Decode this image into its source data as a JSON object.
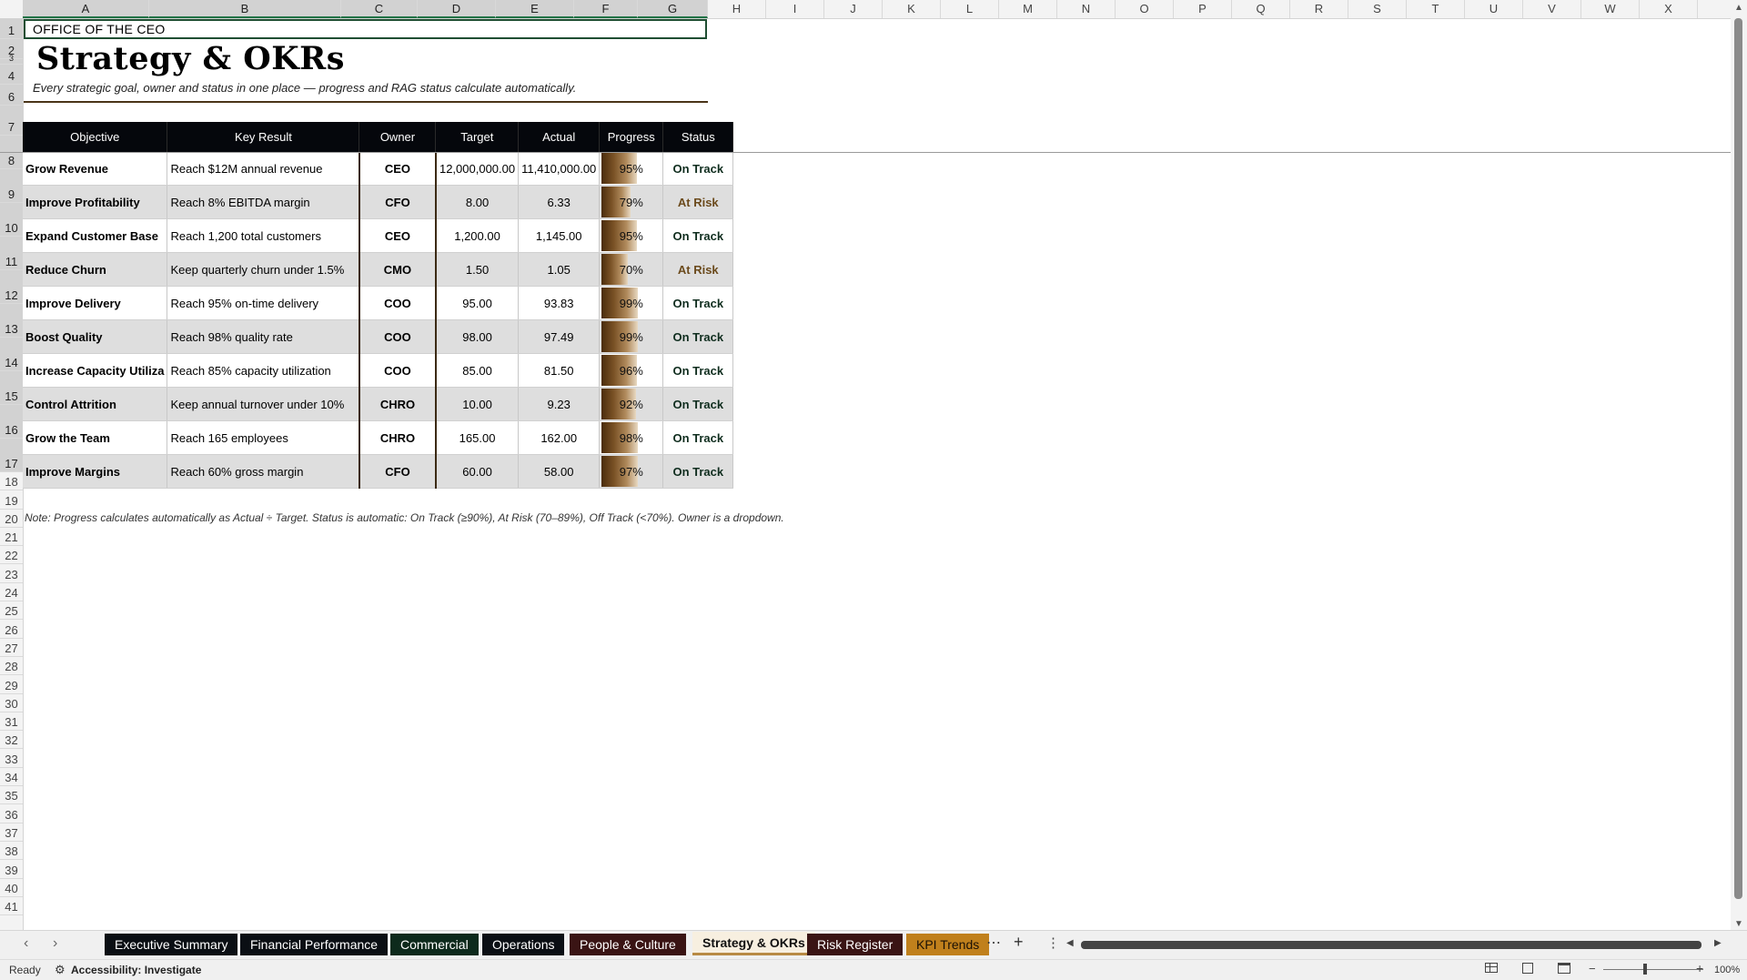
{
  "columns": [
    "A",
    "B",
    "C",
    "D",
    "E",
    "F",
    "G",
    "H",
    "I",
    "J",
    "K",
    "L",
    "M",
    "N",
    "O",
    "P",
    "Q",
    "R",
    "S",
    "T",
    "U",
    "V",
    "W",
    "X"
  ],
  "rows": [
    "1",
    "2",
    "3",
    "4",
    "5",
    "6",
    "7",
    "8",
    "9",
    "10",
    "11",
    "12",
    "13",
    "14",
    "15",
    "16",
    "17",
    "18",
    "19",
    "20",
    "21",
    "22",
    "23",
    "24",
    "25",
    "26",
    "27",
    "28",
    "29",
    "30",
    "31",
    "32",
    "33",
    "34",
    "35",
    "36",
    "37",
    "38",
    "39",
    "40",
    "41"
  ],
  "sheet": {
    "ceo_label": "OFFICE OF THE CEO",
    "title": "Strategy & OKRs",
    "subtitle": "Every strategic goal, owner and status in one place — progress and RAG status calculate automatically.",
    "note": "Note: Progress calculates automatically as Actual ÷ Target. Status is automatic: On Track (≥90%), At Risk (70–89%), Off Track (<70%). Owner is a dropdown."
  },
  "table": {
    "headers": [
      "Objective",
      "Key Result",
      "Owner",
      "Target",
      "Actual",
      "Progress",
      "Status"
    ],
    "rows": [
      {
        "objective": "Grow Revenue",
        "key_result": "Reach $12M annual revenue",
        "owner": "CEO",
        "target": "12,000,000.00",
        "actual": "11,410,000.00",
        "progress": "95%",
        "progress_value": 0.95,
        "status": "On Track"
      },
      {
        "objective": "Improve Profitability",
        "key_result": "Reach 8% EBITDA margin",
        "owner": "CFO",
        "target": "8.00",
        "actual": "6.33",
        "progress": "79%",
        "progress_value": 0.79,
        "status": "At Risk"
      },
      {
        "objective": "Expand Customer Base",
        "key_result": "Reach 1,200 total customers",
        "owner": "CEO",
        "target": "1,200.00",
        "actual": "1,145.00",
        "progress": "95%",
        "progress_value": 0.95,
        "status": "On Track"
      },
      {
        "objective": "Reduce Churn",
        "key_result": "Keep quarterly churn under 1.5%",
        "owner": "CMO",
        "target": "1.50",
        "actual": "1.05",
        "progress": "70%",
        "progress_value": 0.7,
        "status": "At Risk"
      },
      {
        "objective": "Improve Delivery",
        "key_result": "Reach 95% on-time delivery",
        "owner": "COO",
        "target": "95.00",
        "actual": "93.83",
        "progress": "99%",
        "progress_value": 0.99,
        "status": "On Track"
      },
      {
        "objective": "Boost Quality",
        "key_result": "Reach 98% quality rate",
        "owner": "COO",
        "target": "98.00",
        "actual": "97.49",
        "progress": "99%",
        "progress_value": 0.99,
        "status": "On Track"
      },
      {
        "objective": "Increase Capacity Utiliza",
        "key_result": "Reach 85% capacity utilization",
        "owner": "COO",
        "target": "85.00",
        "actual": "81.50",
        "progress": "96%",
        "progress_value": 0.96,
        "status": "On Track"
      },
      {
        "objective": "Control Attrition",
        "key_result": "Keep annual turnover under 10%",
        "owner": "CHRO",
        "target": "10.00",
        "actual": "9.23",
        "progress": "92%",
        "progress_value": 0.92,
        "status": "On Track"
      },
      {
        "objective": "Grow the Team",
        "key_result": "Reach 165 employees",
        "owner": "CHRO",
        "target": "165.00",
        "actual": "162.00",
        "progress": "98%",
        "progress_value": 0.98,
        "status": "On Track"
      },
      {
        "objective": "Improve Margins",
        "key_result": "Reach 60% gross margin",
        "owner": "CFO",
        "target": "60.00",
        "actual": "58.00",
        "progress": "97%",
        "progress_value": 0.97,
        "status": "On Track"
      }
    ]
  },
  "tabs": [
    {
      "label": "Executive Summary",
      "style": "dark"
    },
    {
      "label": "Financial Performance",
      "style": "dark"
    },
    {
      "label": "Commercial",
      "style": "green"
    },
    {
      "label": "Operations",
      "style": "dark"
    },
    {
      "label": "People & Culture",
      "style": "maroon"
    },
    {
      "label": "Strategy & OKRs",
      "style": "active"
    },
    {
      "label": "Risk Register",
      "style": "maroon"
    },
    {
      "label": "KPI Trends",
      "style": "gold"
    }
  ],
  "status_bar": {
    "ready": "Ready",
    "accessibility": "Accessibility: Investigate",
    "zoom": "100%"
  },
  "colors": {
    "header_bg": "#05070c",
    "on_track": "#0f2d1e",
    "at_risk": "#6b4a1c",
    "progress_bar": "#7a5226"
  }
}
